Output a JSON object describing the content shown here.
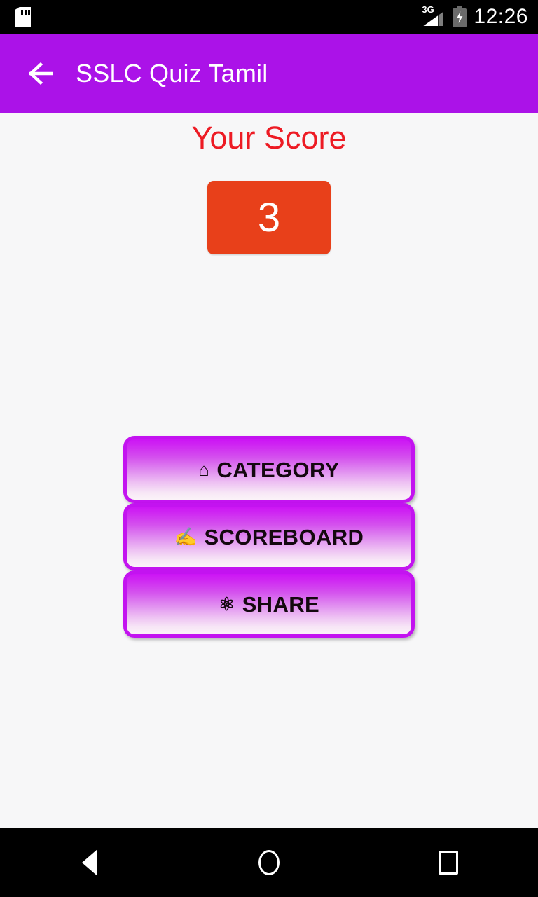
{
  "status_bar": {
    "sd_card_icon": "sd-card-icon",
    "network_type": "3G",
    "signal_icon": "signal-bars-icon",
    "battery_icon": "battery-charging-icon",
    "time": "12:26"
  },
  "app_bar": {
    "back_icon": "back-arrow-icon",
    "title": "SSLC Quiz Tamil",
    "background_color": "#ab12e8"
  },
  "main": {
    "score_heading": "Your Score",
    "score_heading_color": "#ed1b24",
    "score_value": "3",
    "score_box_color": "#e8401a",
    "buttons": [
      {
        "label": "CATEGORY",
        "icon": "⌂",
        "icon_name": "home-icon"
      },
      {
        "label": "SCOREBOARD",
        "icon": "✍",
        "icon_name": "writing-hand-icon"
      },
      {
        "label": "SHARE",
        "icon": "⚛",
        "icon_name": "atom-icon"
      }
    ],
    "button_border_color": "#c313f0"
  },
  "nav_bar": {
    "back_label": "Back",
    "home_label": "Home",
    "recents_label": "Recents"
  }
}
